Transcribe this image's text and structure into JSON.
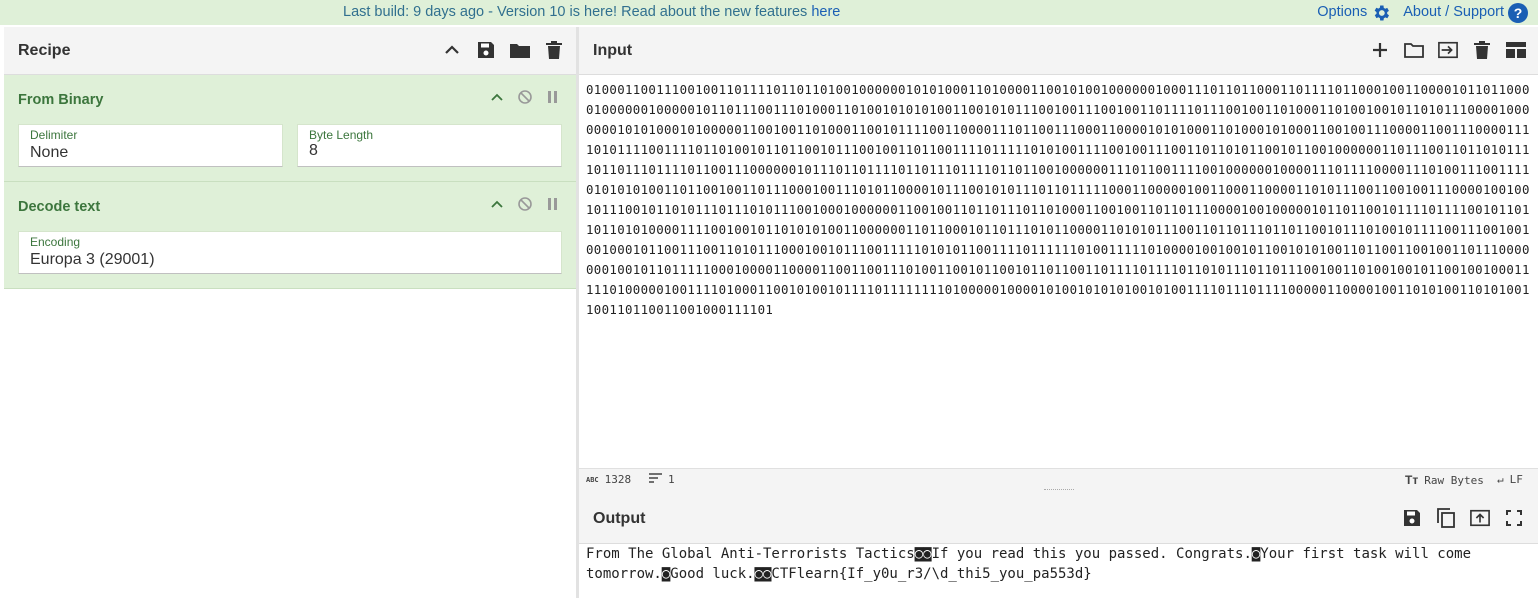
{
  "banner": {
    "last_build": "Last build: 9 days ago",
    "version_text": " - Version 10 is here! Read about the new features ",
    "here_link": "here",
    "options_label": "Options",
    "about_label": "About / Support"
  },
  "recipe": {
    "title": "Recipe",
    "icons": [
      "chevron-up-icon",
      "save-icon",
      "folder-icon",
      "trash-icon"
    ],
    "operations": [
      {
        "name": "From Binary",
        "fields": [
          {
            "label": "Delimiter",
            "value": "None"
          },
          {
            "label": "Byte Length",
            "value": "8"
          }
        ]
      },
      {
        "name": "Decode text",
        "fields": [
          {
            "label": "Encoding",
            "value": "Europa 3 (29001)"
          }
        ]
      }
    ]
  },
  "input": {
    "title": "Input",
    "icons": [
      "plus-icon",
      "open-folder-icon",
      "input-icon",
      "trash-icon",
      "layout-icon"
    ],
    "text": "01000110011100100110111101101101001000000101010001101000011001010010000001000111011011000110111101100010011000010110110000100000010000010110111001110100011010010101010011001010111001001110010011011110111001001101000110100100101101011100001000000010101000101000001100100110100011001011110011000011101100111000110000101010001101000101000110010011100001100111000011110101111001111011010010110110010111001001101100111101111101010011110010011100110110101100101100100000011011100110110101111011011101111011001110000001011101101111011011101111011011001000000111011001111001000000100001110111100001110100111001111010101010011011001001101110001001110101100001011100101011101101111100011000001001100011000011010111001100100111000010010010111001011010111011101011100100010000001100100110110111011010001100100110110111000010010000010110110010111101111001011011011010100001111001001011010101001100000011011000101101110101100001101010111001101101110110110010111010010111100111001001001000101100111001101011100010010111001111101010110011110111111010011111010000100100101100101010011011001100100110111000000010010110111110001000011000011001100111010011001011001011011001101111011110110101110110111001001101001001011001001000111110100000100111101000110010100101111011111111010000010000101001010101001010011110111011110000011000010011010100110101001100110110011001000111101"
  },
  "status": {
    "length": "1328",
    "lines": "1",
    "encoding": "Raw Bytes",
    "eol": "LF"
  },
  "output": {
    "title": "Output",
    "icons": [
      "save-icon",
      "copy-icon",
      "replace-input-icon",
      "maximize-icon"
    ],
    "text": "From The Global Anti-Terrorists Tactics◙◙If you read this you passed. Congrats.◙Your first task will come tomorrow.◙Good luck.◙◙CTFlearn{If_y0u_r3/\\d_thi5_you_pa553d}"
  },
  "colors": {
    "banner_bg": "#dff0d8",
    "operation_bg": "#dff0d8",
    "operation_title": "#3c763d",
    "link": "#1a5fb4"
  }
}
